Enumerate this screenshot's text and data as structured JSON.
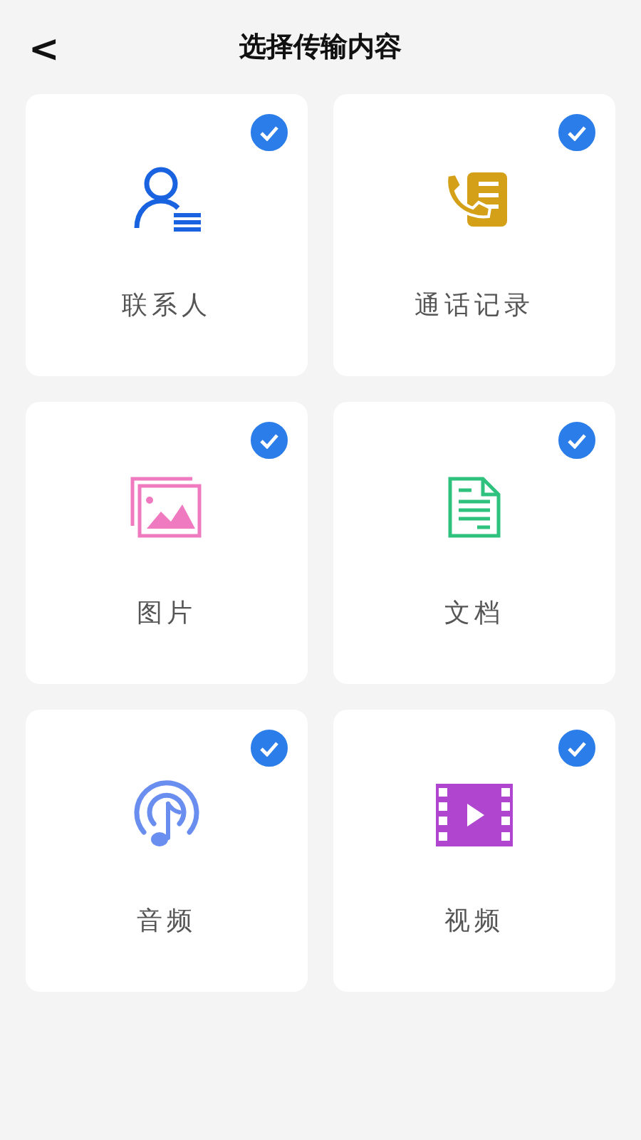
{
  "header": {
    "back": "<",
    "title": "选择传输内容"
  },
  "items": [
    {
      "kind": "contacts",
      "label": "联系人",
      "selected": true
    },
    {
      "kind": "calls",
      "label": "通话记录",
      "selected": true
    },
    {
      "kind": "images",
      "label": "图片",
      "selected": true
    },
    {
      "kind": "documents",
      "label": "文档",
      "selected": true
    },
    {
      "kind": "audio",
      "label": "音频",
      "selected": true
    },
    {
      "kind": "video",
      "label": "视频",
      "selected": true
    }
  ]
}
